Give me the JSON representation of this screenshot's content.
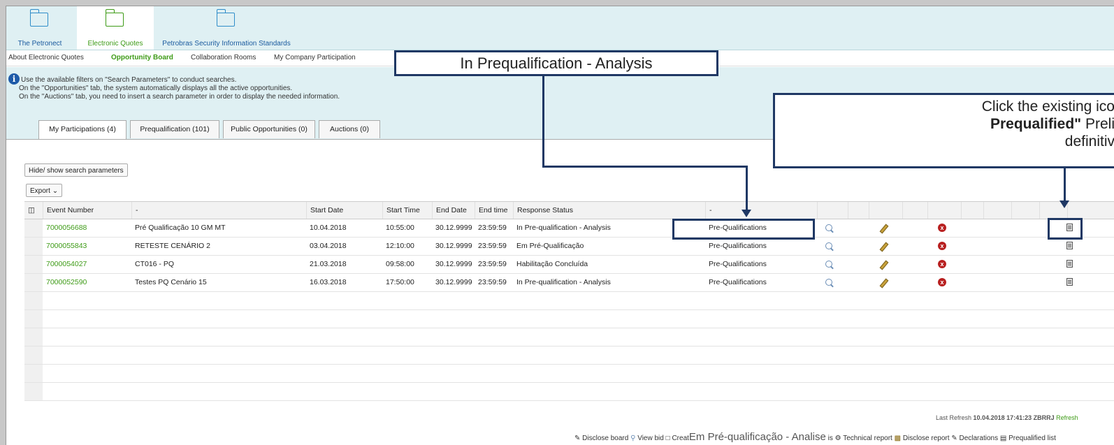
{
  "top_tabs": [
    {
      "label": "The Petronect"
    },
    {
      "label": "Electronic Quotes"
    },
    {
      "label": "Petrobras Security Information Standards"
    }
  ],
  "subnav": [
    "About Electronic Quotes",
    "Opportunity Board",
    "Collaboration Rooms",
    "My Company Participation"
  ],
  "info": {
    "line1": "Use the available filters on \"Search Parameters\" to conduct searches.",
    "line2": "On the \"Opportunities\" tab, the system automatically displays all the active opportunities.",
    "line3": "On the \"Auctions\" tab, you need to insert a search parameter in order to display the needed information."
  },
  "tabs": [
    "My Participations (4)",
    "Prequalification (101)",
    "Public Opportunities (0)",
    "Auctions (0)"
  ],
  "buttons": {
    "hide_show": "Hide/ show search parameters",
    "export": "Export"
  },
  "columns": [
    "Event Number",
    "-",
    "Start Date",
    "Start Time",
    "End Date",
    "End time",
    "Response Status",
    "-"
  ],
  "rows": [
    {
      "event": "7000056688",
      "desc": "Pré Qualificação 10 GM MT",
      "start_date": "10.04.2018",
      "start_time": "10:55:00",
      "end_date": "30.12.9999",
      "end_time": "23:59:59",
      "status": "In Pre-qualification - Analysis",
      "type": "Pre-Qualifications"
    },
    {
      "event": "7000055843",
      "desc": "RETESTE CENÁRIO 2",
      "start_date": "03.04.2018",
      "start_time": "12:10:00",
      "end_date": "30.12.9999",
      "end_time": "23:59:59",
      "status": "Em Pré-Qualificação",
      "type": "Pre-Qualifications"
    },
    {
      "event": "7000054027",
      "desc": "CT016 - PQ",
      "start_date": "21.03.2018",
      "start_time": "09:58:00",
      "end_date": "30.12.9999",
      "end_time": "23:59:59",
      "status": "Habilitação Concluída",
      "type": "Pre-Qualifications"
    },
    {
      "event": "7000052590",
      "desc": "Testes PQ Cenário 15",
      "start_date": "16.03.2018",
      "start_time": "17:50:00",
      "end_date": "30.12.9999",
      "end_time": "23:59:59",
      "status": "In Pre-qualification - Analysis",
      "type": "Pre-Qualifications"
    }
  ],
  "last_refresh": {
    "label": "Last Refresh",
    "value": "10.04.2018 17:41:23 ZBRRJ",
    "action": "Refresh"
  },
  "legend": {
    "disclose_board": "Disclose board",
    "view_bid": "View bid",
    "create_prefix": "Creat",
    "create_overlay": "Em Pré-qualificação - Analise",
    "create_suffix": "is",
    "technical_report": "Technical report",
    "disclose_report": "Disclose report",
    "declarations": "Declarations",
    "prequalified_list": "Prequalified list"
  },
  "callouts": {
    "status": "In Prequalification - Analysis",
    "click_line1": "Click the existing ico",
    "click_line2_bold": "Prequalified\"",
    "click_line2_rest": " Preli",
    "click_line3": "definitiv"
  }
}
